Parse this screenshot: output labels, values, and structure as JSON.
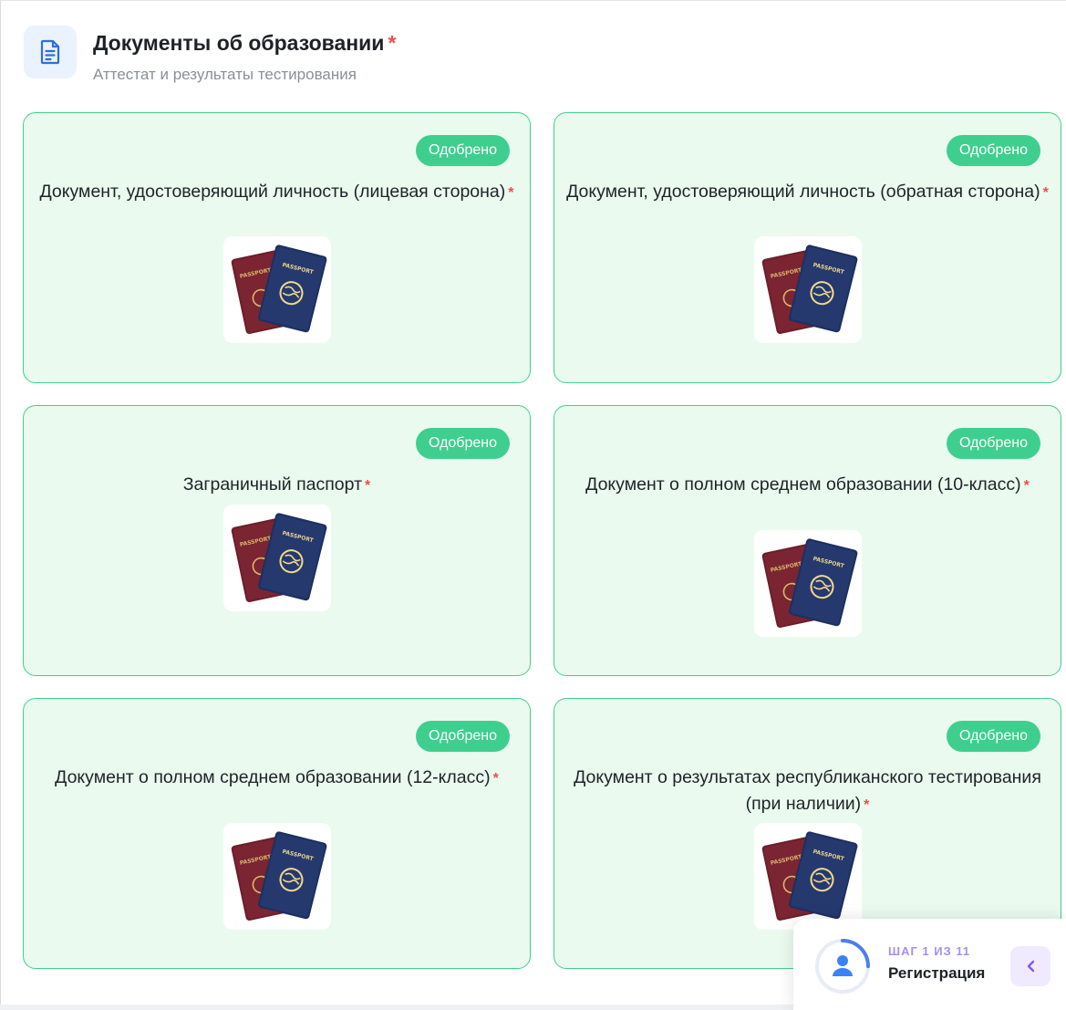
{
  "section": {
    "title": "Документы об образовании",
    "required_mark": "*",
    "subtitle": "Аттестат и результаты тестирования",
    "icon": "document-icon"
  },
  "cards": [
    {
      "status": "Одобрено",
      "title": "Документ, удостоверяющий личность (лицевая сторона)",
      "required_mark": "*",
      "thumbnail": "passport-icon"
    },
    {
      "status": "Одобрено",
      "title": "Документ, удостоверяющий личность (обратная сторона)",
      "required_mark": "*",
      "thumbnail": "passport-icon"
    },
    {
      "status": "Одобрено",
      "title": "Заграничный паспорт",
      "required_mark": "*",
      "thumbnail": "passport-icon"
    },
    {
      "status": "Одобрено",
      "title": "Документ о полном среднем образовании (10-класс)",
      "required_mark": "*",
      "thumbnail": "passport-icon"
    },
    {
      "status": "Одобрено",
      "title": "Документ о полном среднем образовании (12-класс)",
      "required_mark": "*",
      "thumbnail": "passport-icon"
    },
    {
      "status": "Одобрено",
      "title": "Документ о результатах республиканского тестирования (при наличии)",
      "required_mark": "*",
      "thumbnail": "passport-icon"
    }
  ],
  "stepper": {
    "step_label": "ШАГ 1 ИЗ 11",
    "step_name": "Регистрация",
    "current_step": 1,
    "total_steps": 11,
    "icon": "user-icon",
    "collapse_icon": "chevron-left-icon"
  },
  "colors": {
    "card_bg": "#eafaef",
    "card_border": "#40d08c",
    "badge": "#3ecf8e",
    "required": "#f04e4e",
    "accent_blue": "#3b82f6",
    "accent_purple": "#a48ff0"
  }
}
